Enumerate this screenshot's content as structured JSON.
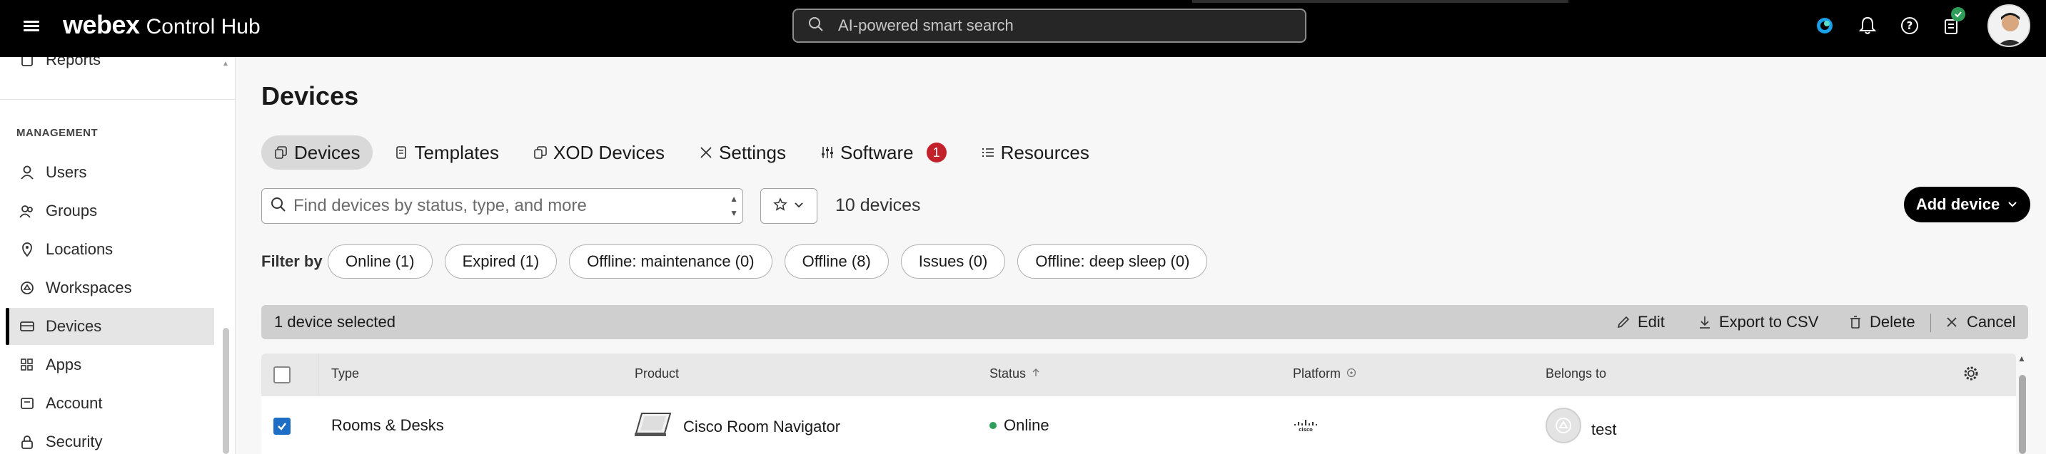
{
  "topbar": {
    "brand_logo": "webex",
    "brand_product": "Control Hub",
    "search_placeholder": "AI-powered smart search",
    "icons": [
      "menu-icon",
      "search-icon",
      "webex-assistant-icon",
      "bell-icon",
      "help-icon",
      "tasks-icon",
      "avatar"
    ]
  },
  "sidebar": {
    "partial_item": "Reports",
    "section_heading": "MANAGEMENT",
    "items": [
      {
        "label": "Users",
        "icon": "user-icon"
      },
      {
        "label": "Groups",
        "icon": "groups-icon"
      },
      {
        "label": "Locations",
        "icon": "location-pin-icon"
      },
      {
        "label": "Workspaces",
        "icon": "workspace-icon"
      },
      {
        "label": "Devices",
        "icon": "device-icon",
        "active": true
      },
      {
        "label": "Apps",
        "icon": "apps-icon"
      },
      {
        "label": "Account",
        "icon": "account-icon"
      },
      {
        "label": "Security",
        "icon": "lock-icon"
      }
    ]
  },
  "main": {
    "title": "Devices",
    "tabs": [
      {
        "label": "Devices",
        "active": true
      },
      {
        "label": "Templates"
      },
      {
        "label": "XOD Devices"
      },
      {
        "label": "Settings"
      },
      {
        "label": "Software",
        "badge": "1"
      },
      {
        "label": "Resources"
      }
    ],
    "search_placeholder": "Find devices by status, type, and more",
    "device_count": "10 devices",
    "add_device_label": "Add device",
    "filter_label": "Filter by",
    "filters": [
      "Online (1)",
      "Expired (1)",
      "Offline: maintenance (0)",
      "Offline (8)",
      "Issues (0)",
      "Offline: deep sleep (0)"
    ],
    "selection": {
      "text": "1 device selected",
      "actions": {
        "edit": "Edit",
        "export": "Export to CSV",
        "delete": "Delete",
        "cancel": "Cancel"
      }
    },
    "table": {
      "columns": [
        "Type",
        "Product",
        "Status",
        "Platform",
        "Belongs to"
      ],
      "rows": [
        {
          "checked": true,
          "type": "Rooms & Desks",
          "product": "Cisco Room Navigator",
          "status": "Online",
          "platform_logo": "cisco",
          "belongs_to": "test"
        }
      ]
    }
  },
  "colors": {
    "topbar_bg": "#000000",
    "accent_blue": "#1f6ec6",
    "badge_red": "#c4222a",
    "online_green": "#2f9e5a"
  }
}
